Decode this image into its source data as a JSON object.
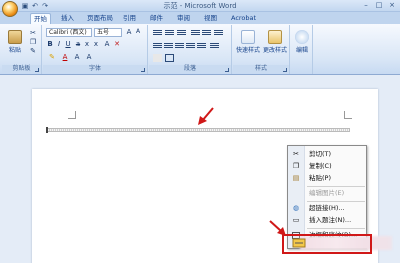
{
  "window": {
    "title": "示范 - Microsoft Word"
  },
  "quick_access": {
    "save_icon": "save-icon",
    "undo_icon": "undo-icon",
    "redo_icon": "redo-icon"
  },
  "tabs": [
    {
      "label": "开始",
      "active": true
    },
    {
      "label": "插入"
    },
    {
      "label": "页面布局"
    },
    {
      "label": "引用"
    },
    {
      "label": "邮件"
    },
    {
      "label": "审阅"
    },
    {
      "label": "视图"
    },
    {
      "label": "Acrobat"
    }
  ],
  "ribbon": {
    "clipboard": {
      "label": "剪贴板",
      "paste_label": "粘贴"
    },
    "font": {
      "label": "字体",
      "font_name": "Calibri (西文)",
      "font_size": "五号"
    },
    "paragraph": {
      "label": "段落"
    },
    "styles": {
      "label": "样式",
      "quick_styles": "快速样式",
      "change_styles": "更改样式"
    },
    "editing": {
      "label": "编辑"
    }
  },
  "context_menu": {
    "items": [
      {
        "label": "剪切(T)",
        "icon": "scissors-icon",
        "enabled": true
      },
      {
        "label": "复制(C)",
        "icon": "copy-icon",
        "enabled": true
      },
      {
        "label": "粘贴(P)",
        "icon": "paste-icon",
        "enabled": true
      },
      {
        "label": "编辑图片(E)",
        "icon": "edit-picture-icon",
        "enabled": false
      },
      {
        "label": "超链接(H)...",
        "icon": "hyperlink-icon",
        "enabled": true
      },
      {
        "label": "插入题注(N)...",
        "icon": "caption-icon",
        "enabled": true
      },
      {
        "label": "边框和底纹(B)...",
        "icon": "borders-icon",
        "enabled": true
      }
    ]
  },
  "colors": {
    "highlight_box": "#d01818",
    "arrow": "#d01818"
  }
}
